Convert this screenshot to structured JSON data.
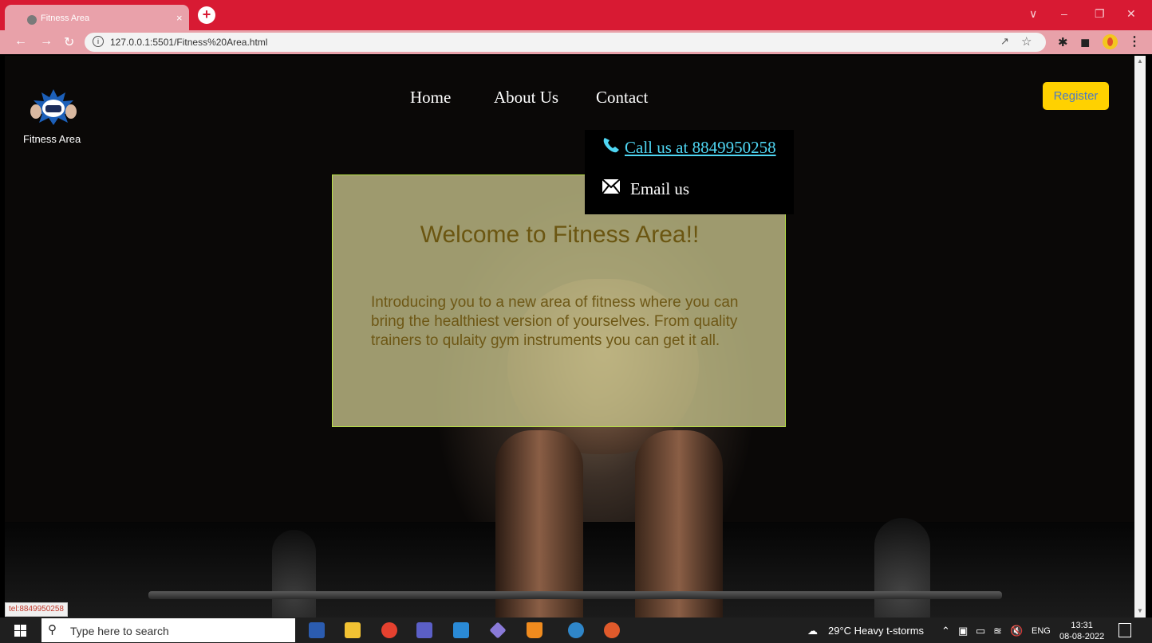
{
  "browser": {
    "tab_title": "Fitness Area",
    "tab_close": "×",
    "new_tab": "+",
    "url": "127.0.0.1:5501/Fitness%20Area.html",
    "window_controls": [
      "∨",
      "–",
      "❐",
      "✕"
    ]
  },
  "page": {
    "logo_text": "Fitness Area",
    "nav": [
      "Home",
      "About Us",
      "Contact"
    ],
    "register_label": "Register",
    "contact_dropdown": {
      "phone_label": " Call us at 8849950258",
      "email_label": "Email us"
    },
    "welcome_title": "Welcome to Fitness Area!!",
    "welcome_body": "Introducing you to a new area of fitness where you can bring the healthiest version of yourselves. From quality trainers to qulaity gym instruments you can get it all."
  },
  "status_bar": {
    "link_preview": "tel:8849950258"
  },
  "taskbar": {
    "search_placeholder": "Type here to search",
    "weather": "29°C  Heavy t-storms",
    "language": "ENG",
    "time": "13:31",
    "date": "08-08-2022"
  },
  "colors": {
    "tab_strip": "#d81a33",
    "register_bg": "#ffd100",
    "phone_link": "#4fd6f3",
    "card_border": "#b8e046"
  }
}
